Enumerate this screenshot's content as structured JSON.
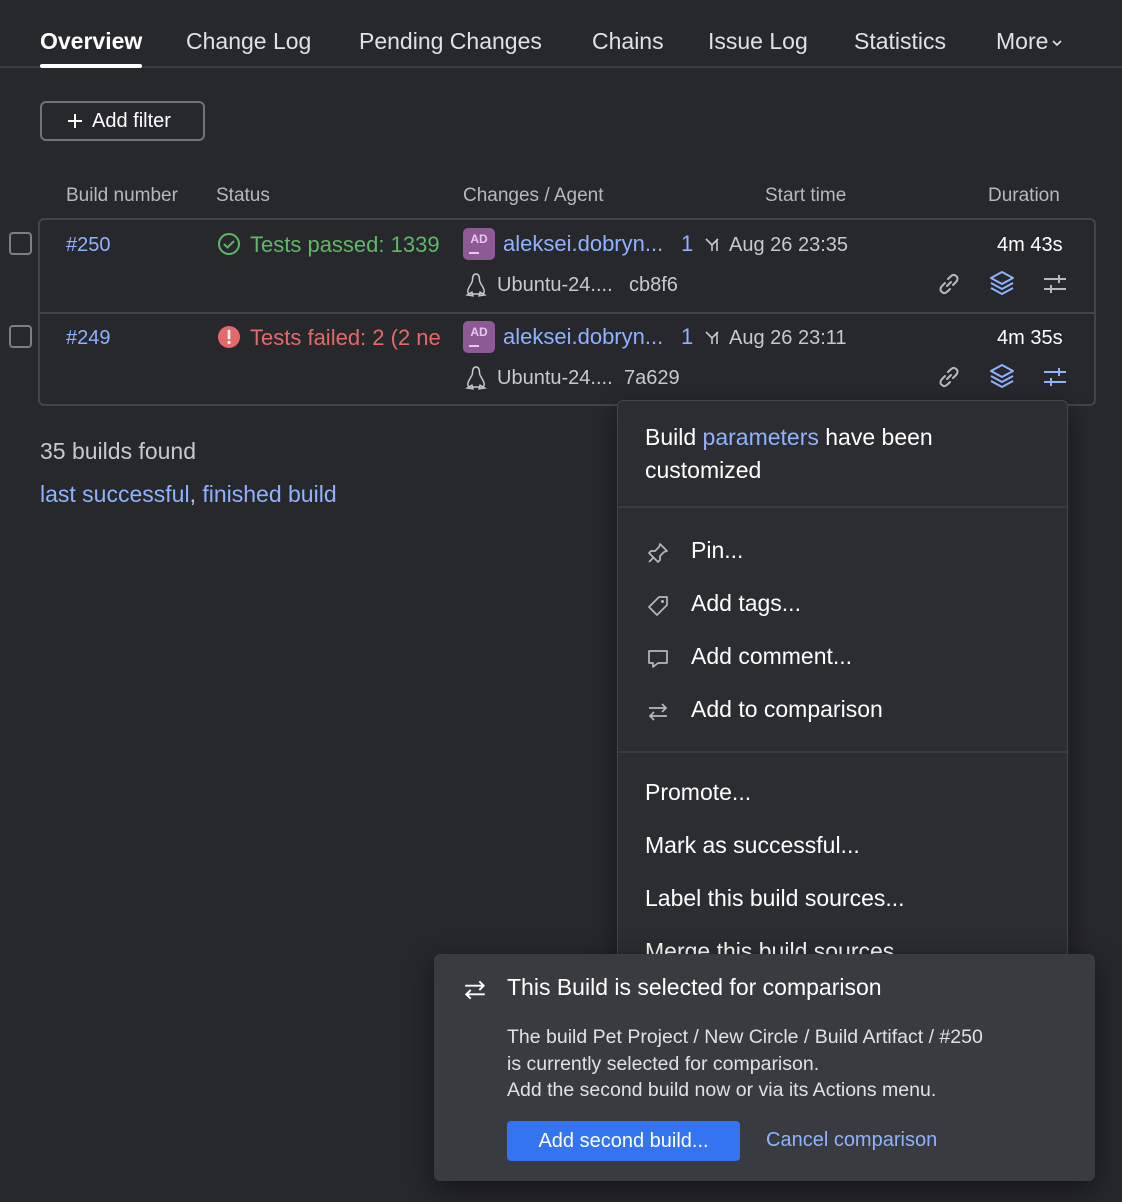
{
  "tabs": [
    {
      "label": "Overview",
      "active": true
    },
    {
      "label": "Change Log"
    },
    {
      "label": "Pending Changes"
    },
    {
      "label": "Chains"
    },
    {
      "label": "Issue Log"
    },
    {
      "label": "Statistics"
    },
    {
      "label": "More"
    }
  ],
  "filter": {
    "add_label": "Add filter"
  },
  "columns": [
    "Build number",
    "Status",
    "Changes / Agent",
    "Start time",
    "Duration"
  ],
  "builds": [
    {
      "number": "#250",
      "status": "Tests passed: 1339",
      "status_kind": "success",
      "avatar": "AD",
      "user": "aleksei.dobryn...",
      "changes_count": "1",
      "start_time": "Aug 26 23:35",
      "agent": "Ubuntu-24....",
      "revision": "cb8f6",
      "duration": "4m 43s"
    },
    {
      "number": "#249",
      "status": "Tests failed: 2 (2 ne",
      "status_kind": "failure",
      "avatar": "AD",
      "user": "aleksei.dobryn...",
      "changes_count": "1",
      "start_time": "Aug 26 23:11",
      "agent": "Ubuntu-24....",
      "revision": "7a629",
      "duration": "4m 35s"
    }
  ],
  "summary": {
    "found": "35 builds found",
    "link_last_successful": "last successful",
    "separator": ",",
    "link_finished": "finished build"
  },
  "menu": {
    "head_pre": "Build",
    "head_link": "parameters",
    "head_post": "have been customized",
    "items": [
      {
        "label": "Pin...",
        "icon": "pin-icon"
      },
      {
        "label": "Add tags...",
        "icon": "tag-icon"
      },
      {
        "label": "Add comment...",
        "icon": "comment-icon"
      },
      {
        "label": "Add to comparison",
        "icon": "compare-icon"
      }
    ],
    "actions": [
      "Promote...",
      "Mark as successful...",
      "Label this build sources...",
      "Merge this build sources..."
    ]
  },
  "comparison": {
    "title": "This Build is selected for comparison",
    "line1": "The build Pet Project / New Circle / Build Artifact / #250",
    "line2": "is currently selected for comparison.",
    "line3": "Add the second build now or via its Actions menu.",
    "primary": "Add second build...",
    "cancel": "Cancel comparison"
  },
  "colors": {
    "background": "#27282c",
    "link": "#8fb2ff",
    "success": "#5fb865",
    "failure": "#e46a6a",
    "primary_button": "#3574f0"
  }
}
